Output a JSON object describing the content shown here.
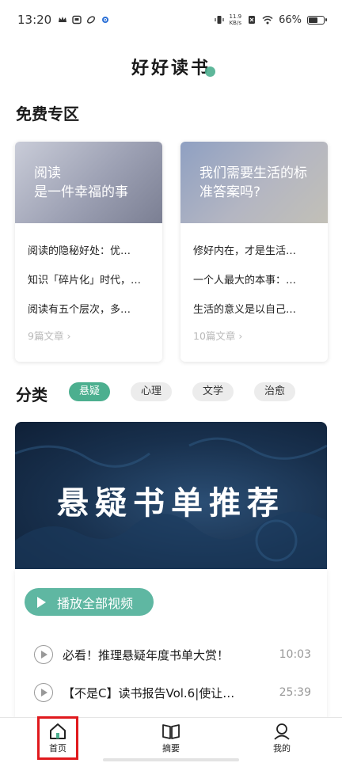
{
  "status_bar": {
    "time": "13:20",
    "speed_value": "11.9",
    "speed_unit": "KB/s",
    "battery": "66%",
    "battery_level": 0.66
  },
  "header": {
    "title": "好好读书"
  },
  "free_zone": {
    "title": "免费专区",
    "cards": [
      {
        "cover_line1": "阅读",
        "cover_line2": "是一件幸福的事",
        "items": [
          "阅读的隐秘好处：优…",
          "知识「碎片化」时代，…",
          "阅读有五个层次，多…"
        ],
        "count": "9篇文章"
      },
      {
        "cover_line1": "我们需要生活的标",
        "cover_line2": "准答案吗?",
        "items": [
          "修好内在，才是生活…",
          "一个人最大的本事：…",
          "生活的意义是以自己…"
        ],
        "count": "10篇文章"
      }
    ]
  },
  "categories": {
    "title": "分类",
    "tags": [
      "悬疑",
      "心理",
      "文学",
      "治愈"
    ],
    "active": "悬疑"
  },
  "banner": {
    "text": "悬疑书单推荐"
  },
  "play_all": {
    "label": "播放全部视频"
  },
  "videos": [
    {
      "title": "必看！推理悬疑年度书单大赏！",
      "duration": "10:03"
    },
    {
      "title": "【不是C】读书报告Vol.6|使让…",
      "duration": "25:39"
    }
  ],
  "bottom_nav": {
    "items": [
      {
        "label": "首页",
        "icon": "home-icon"
      },
      {
        "label": "摘要",
        "icon": "book-icon"
      },
      {
        "label": "我的",
        "icon": "person-icon"
      }
    ],
    "selected": "首页"
  },
  "colors": {
    "accent": "#4caf8f",
    "highlight_box": "#e0191d"
  }
}
